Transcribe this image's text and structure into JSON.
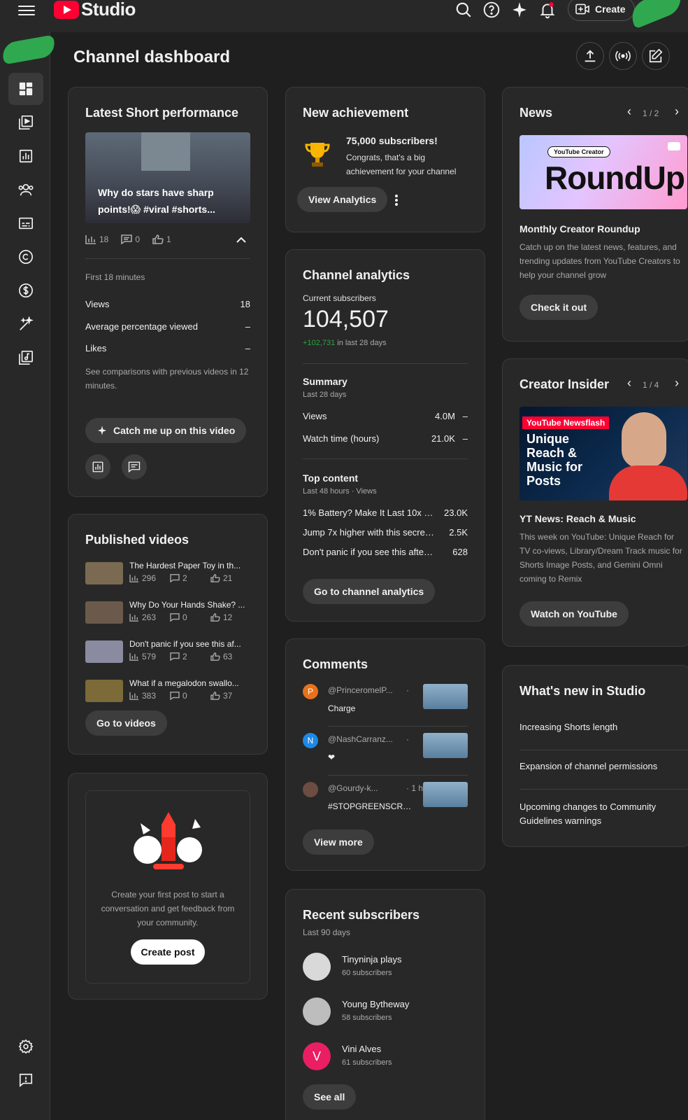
{
  "app": {
    "logo_text": "Studio",
    "create_label": "Create"
  },
  "page_title": "Channel dashboard",
  "sidebar": {
    "items": [
      {
        "icon": "dashboard-icon",
        "active": true
      },
      {
        "icon": "content-icon"
      },
      {
        "icon": "analytics-icon"
      },
      {
        "icon": "community-icon"
      },
      {
        "icon": "subtitles-icon"
      },
      {
        "icon": "copyright-icon"
      },
      {
        "icon": "earn-icon"
      },
      {
        "icon": "customization-icon"
      },
      {
        "icon": "audio-library-icon"
      }
    ],
    "bottom": [
      {
        "icon": "settings-icon"
      },
      {
        "icon": "feedback-icon"
      }
    ]
  },
  "short_perf": {
    "title": "Latest Short performance",
    "video_title": "Why do stars have sharp points!😱 #viral #shorts...",
    "views_stat": "18",
    "comments_stat": "0",
    "likes_stat": "1",
    "period": "First 18 minutes",
    "metrics": [
      {
        "label": "Views",
        "value": "18"
      },
      {
        "label": "Average percentage viewed",
        "value": "–"
      },
      {
        "label": "Likes",
        "value": "–"
      }
    ],
    "note": "See comparisons with previous videos in 12 minutes.",
    "catch_up_label": "Catch me up on this video"
  },
  "published": {
    "title": "Published videos",
    "videos": [
      {
        "title": "The Hardest Paper Toy in th...",
        "views": "296",
        "comments": "2",
        "likes": "21"
      },
      {
        "title": "Why Do Your Hands Shake? ...",
        "views": "263",
        "comments": "0",
        "likes": "12"
      },
      {
        "title": "Don't panic if you see this af...",
        "views": "579",
        "comments": "2",
        "likes": "63"
      },
      {
        "title": "What if a megalodon swallo...",
        "views": "383",
        "comments": "0",
        "likes": "37"
      }
    ],
    "go_label": "Go to videos"
  },
  "post": {
    "text": "Create your first post to start a conversation and get feedback from your community.",
    "button": "Create post"
  },
  "achievement": {
    "title": "New achievement",
    "headline": "75,000 subscribers!",
    "body": "Congrats, that's a big achievement for your channel",
    "button": "View Analytics"
  },
  "analytics": {
    "title": "Channel analytics",
    "subs_label": "Current subscribers",
    "subs_value": "104,507",
    "subs_delta": "+102,731",
    "subs_delta_suffix": "in last 28 days",
    "summary_title": "Summary",
    "summary_period": "Last 28 days",
    "summary": [
      {
        "label": "Views",
        "value": "4.0M",
        "trend": "–"
      },
      {
        "label": "Watch time (hours)",
        "value": "21.0K",
        "trend": "–"
      }
    ],
    "top_title": "Top content",
    "top_period": "Last 48 hours · Views",
    "top": [
      {
        "label": "1% Battery? Make It Last 10x Lo...",
        "value": "23.0K"
      },
      {
        "label": "Jump 7x higher with this secret ...",
        "value": "2.5K"
      },
      {
        "label": "Don't panic if you see this after ...",
        "value": "628"
      }
    ],
    "button": "Go to channel analytics"
  },
  "comments": {
    "title": "Comments",
    "items": [
      {
        "initial": "P",
        "color": "#e8711a",
        "author": "@PrinceromelP...",
        "time": "·",
        "text": "Charge"
      },
      {
        "initial": "N",
        "color": "#1e88e5",
        "author": "@NashCarranz...",
        "time": "·",
        "text": "❤"
      },
      {
        "initial": "",
        "color": "#6d4c41",
        "author": "@Gourdy-k...",
        "time": "· 1 h...",
        "text": "#STOPGREENSCREEN"
      }
    ],
    "button": "View more"
  },
  "recent_subs": {
    "title": "Recent subscribers",
    "period": "Last 90 days",
    "items": [
      {
        "name": "Tinyninja plays",
        "count": "60 subscribers",
        "initial": "",
        "color": "#d9d9d9"
      },
      {
        "name": "Young Bytheway",
        "count": "58 subscribers",
        "initial": "",
        "color": "#bdbdbd"
      },
      {
        "name": "Vini Alves",
        "count": "61 subscribers",
        "initial": "V",
        "color": "#e91e63"
      }
    ],
    "button": "See all"
  },
  "news": {
    "title": "News",
    "pager": "1 / 2",
    "badge": "YouTube Creator",
    "banner": "RoundUp",
    "headline": "Monthly Creator Roundup",
    "body": "Catch up on the latest news, features, and trending updates from YouTube Creators to help your channel grow",
    "button": "Check it out"
  },
  "insider": {
    "title": "Creator Insider",
    "pager": "1 / 4",
    "flash": "YouTube Newsflash",
    "banner": "Unique Reach & Music for Posts",
    "headline": "YT News: Reach & Music",
    "body": "This week on YouTube: Unique Reach for TV co-views, Library/Dream Track music for Shorts Image Posts, and Gemini Omni coming to Remix",
    "button": "Watch on YouTube"
  },
  "whats_new": {
    "title": "What's new in Studio",
    "items": [
      "Increasing Shorts length",
      "Expansion of channel permissions",
      "Upcoming changes to Community Guidelines warnings"
    ]
  },
  "colors": {
    "accent_green": "#2ba640",
    "brand_red": "#ff0033"
  }
}
